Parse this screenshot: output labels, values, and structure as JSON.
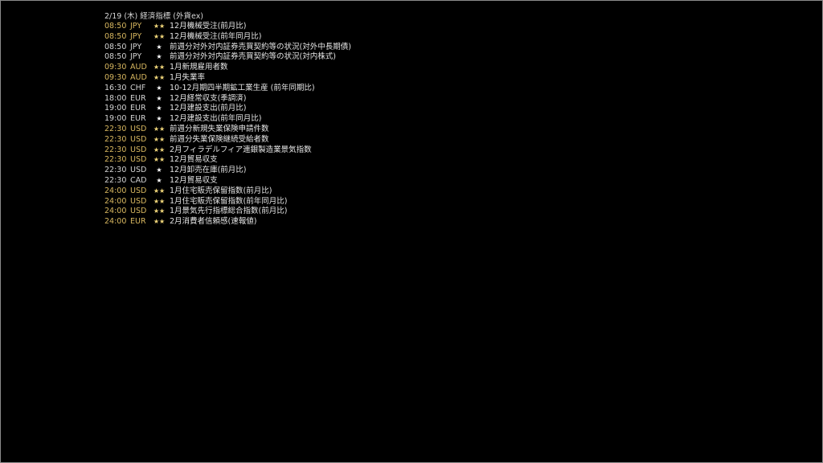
{
  "header": "2/19 (木) 経済指標 (外貨ex)",
  "events": [
    {
      "time": "08:50",
      "currency": "JPY",
      "stars": "★★",
      "title": "12月機械受注(前月比)",
      "level": "major"
    },
    {
      "time": "08:50",
      "currency": "JPY",
      "stars": "★★",
      "title": "12月機械受注(前年同月比)",
      "level": "major"
    },
    {
      "time": "08:50",
      "currency": "JPY",
      "stars": "★",
      "title": "前週分対外対内証券売買契約等の状況(対外中長期債)",
      "level": "minor"
    },
    {
      "time": "08:50",
      "currency": "JPY",
      "stars": "★",
      "title": "前週分対外対内証券売買契約等の状況(対内株式)",
      "level": "minor"
    },
    {
      "time": "09:30",
      "currency": "AUD",
      "stars": "★★",
      "title": "1月新規雇用者数",
      "level": "major"
    },
    {
      "time": "09:30",
      "currency": "AUD",
      "stars": "★★",
      "title": "1月失業率",
      "level": "major"
    },
    {
      "time": "16:30",
      "currency": "CHF",
      "stars": "★",
      "title": "10-12月期四半期鉱工業生産 (前年同期比)",
      "level": "minor"
    },
    {
      "time": "18:00",
      "currency": "EUR",
      "stars": "★",
      "title": "12月経常収支(季調済)",
      "level": "minor"
    },
    {
      "time": "19:00",
      "currency": "EUR",
      "stars": "★",
      "title": "12月建設支出(前月比)",
      "level": "minor"
    },
    {
      "time": "19:00",
      "currency": "EUR",
      "stars": "★",
      "title": "12月建設支出(前年同月比)",
      "level": "minor"
    },
    {
      "time": "22:30",
      "currency": "USD",
      "stars": "★★",
      "title": "前週分新規失業保険申請件数",
      "level": "major"
    },
    {
      "time": "22:30",
      "currency": "USD",
      "stars": "★★",
      "title": "前週分失業保険継続受給者数",
      "level": "major"
    },
    {
      "time": "22:30",
      "currency": "USD",
      "stars": "★★",
      "title": "2月フィラデルフィア連銀製造業景気指数",
      "level": "major"
    },
    {
      "time": "22:30",
      "currency": "USD",
      "stars": "★★",
      "title": "12月貿易収支",
      "level": "major"
    },
    {
      "time": "22:30",
      "currency": "USD",
      "stars": "★",
      "title": "12月卸売在庫(前月比)",
      "level": "minor"
    },
    {
      "time": "22:30",
      "currency": "CAD",
      "stars": "★",
      "title": "12月貿易収支",
      "level": "minor"
    },
    {
      "time": "24:00",
      "currency": "USD",
      "stars": "★★",
      "title": "1月住宅販売保留指数(前月比)",
      "level": "major"
    },
    {
      "time": "24:00",
      "currency": "USD",
      "stars": "★★",
      "title": "1月住宅販売保留指数(前年同月比)",
      "level": "major"
    },
    {
      "time": "24:00",
      "currency": "USD",
      "stars": "★★",
      "title": "1月景気先行指標総合指数(前月比)",
      "level": "major"
    },
    {
      "time": "24:00",
      "currency": "EUR",
      "stars": "★★",
      "title": "2月消費者信頼感(速報値)",
      "level": "major"
    }
  ]
}
